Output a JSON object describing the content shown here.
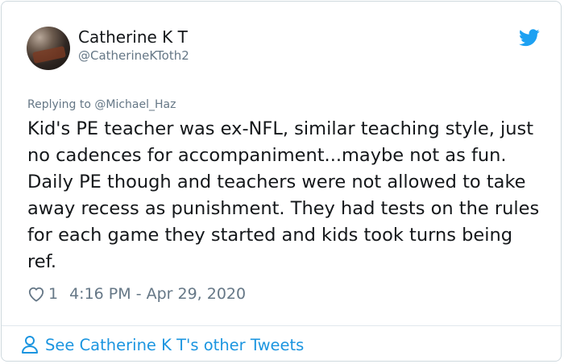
{
  "tweet": {
    "author_name": "Catherine K T",
    "author_handle": "@CatherineKToth2",
    "replying_prefix": "Replying to",
    "replying_to": "@Michael_Haz",
    "text": "Kid's PE teacher was ex-NFL, similar teaching style, just no cadences for accompaniment...maybe not as fun. Daily PE though and teachers were not allowed to take away recess as punishment. They had tests on the rules for each game they started and kids took turns being ref.",
    "like_count": "1",
    "timestamp": "4:16 PM - Apr 29, 2020"
  },
  "footer": {
    "link_label": "See Catherine K T's other Tweets"
  },
  "colors": {
    "brand_blue": "#1da1f2",
    "link_blue": "#1b95e0",
    "muted_gray": "#657786",
    "text_dark": "#14171a"
  },
  "icons": {
    "brand": "twitter-bird-icon",
    "like": "heart-icon",
    "profile": "user-icon"
  }
}
